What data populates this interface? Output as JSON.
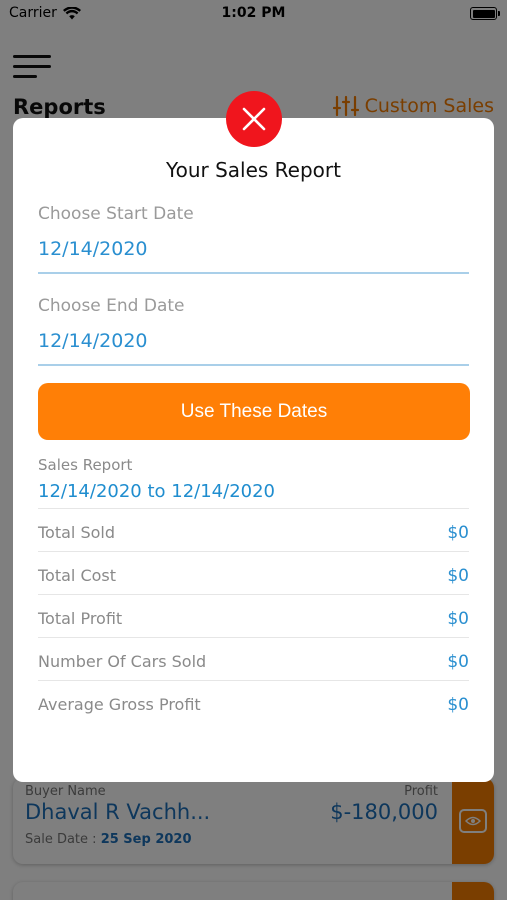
{
  "status_bar": {
    "carrier": "Carrier",
    "time": "1:02 PM"
  },
  "header": {
    "title": "Reports",
    "custom_sales": "Custom Sales"
  },
  "background_card": {
    "buyer_label": "Buyer Name",
    "buyer_name": "Dhaval R Vachh...",
    "profit_label": "Profit",
    "profit_value": "$-180,000",
    "sale_date_label": "Sale Date :",
    "sale_date": "25 Sep 2020"
  },
  "modal": {
    "title": "Your Sales Report",
    "start_label": "Choose Start Date",
    "start_value": "12/14/2020",
    "end_label": "Choose End Date",
    "end_value": "12/14/2020",
    "button_label": "Use These Dates",
    "report_label": "Sales Report",
    "report_range": "12/14/2020 to 12/14/2020",
    "stats": [
      {
        "name": "Total Sold",
        "value": "$0"
      },
      {
        "name": "Total Cost",
        "value": "$0"
      },
      {
        "name": "Total Profit",
        "value": "$0"
      },
      {
        "name": "Number Of Cars Sold",
        "value": "$0"
      },
      {
        "name": "Average Gross Profit",
        "value": "$0"
      }
    ]
  },
  "colors": {
    "accent": "#ff7f06",
    "link": "#2a8fd0",
    "close": "#f0151d"
  },
  "icons": {
    "close": "close-icon",
    "wifi": "wifi-icon",
    "filter": "filter-sliders-icon",
    "eye": "eye-icon",
    "menu": "hamburger-icon"
  }
}
